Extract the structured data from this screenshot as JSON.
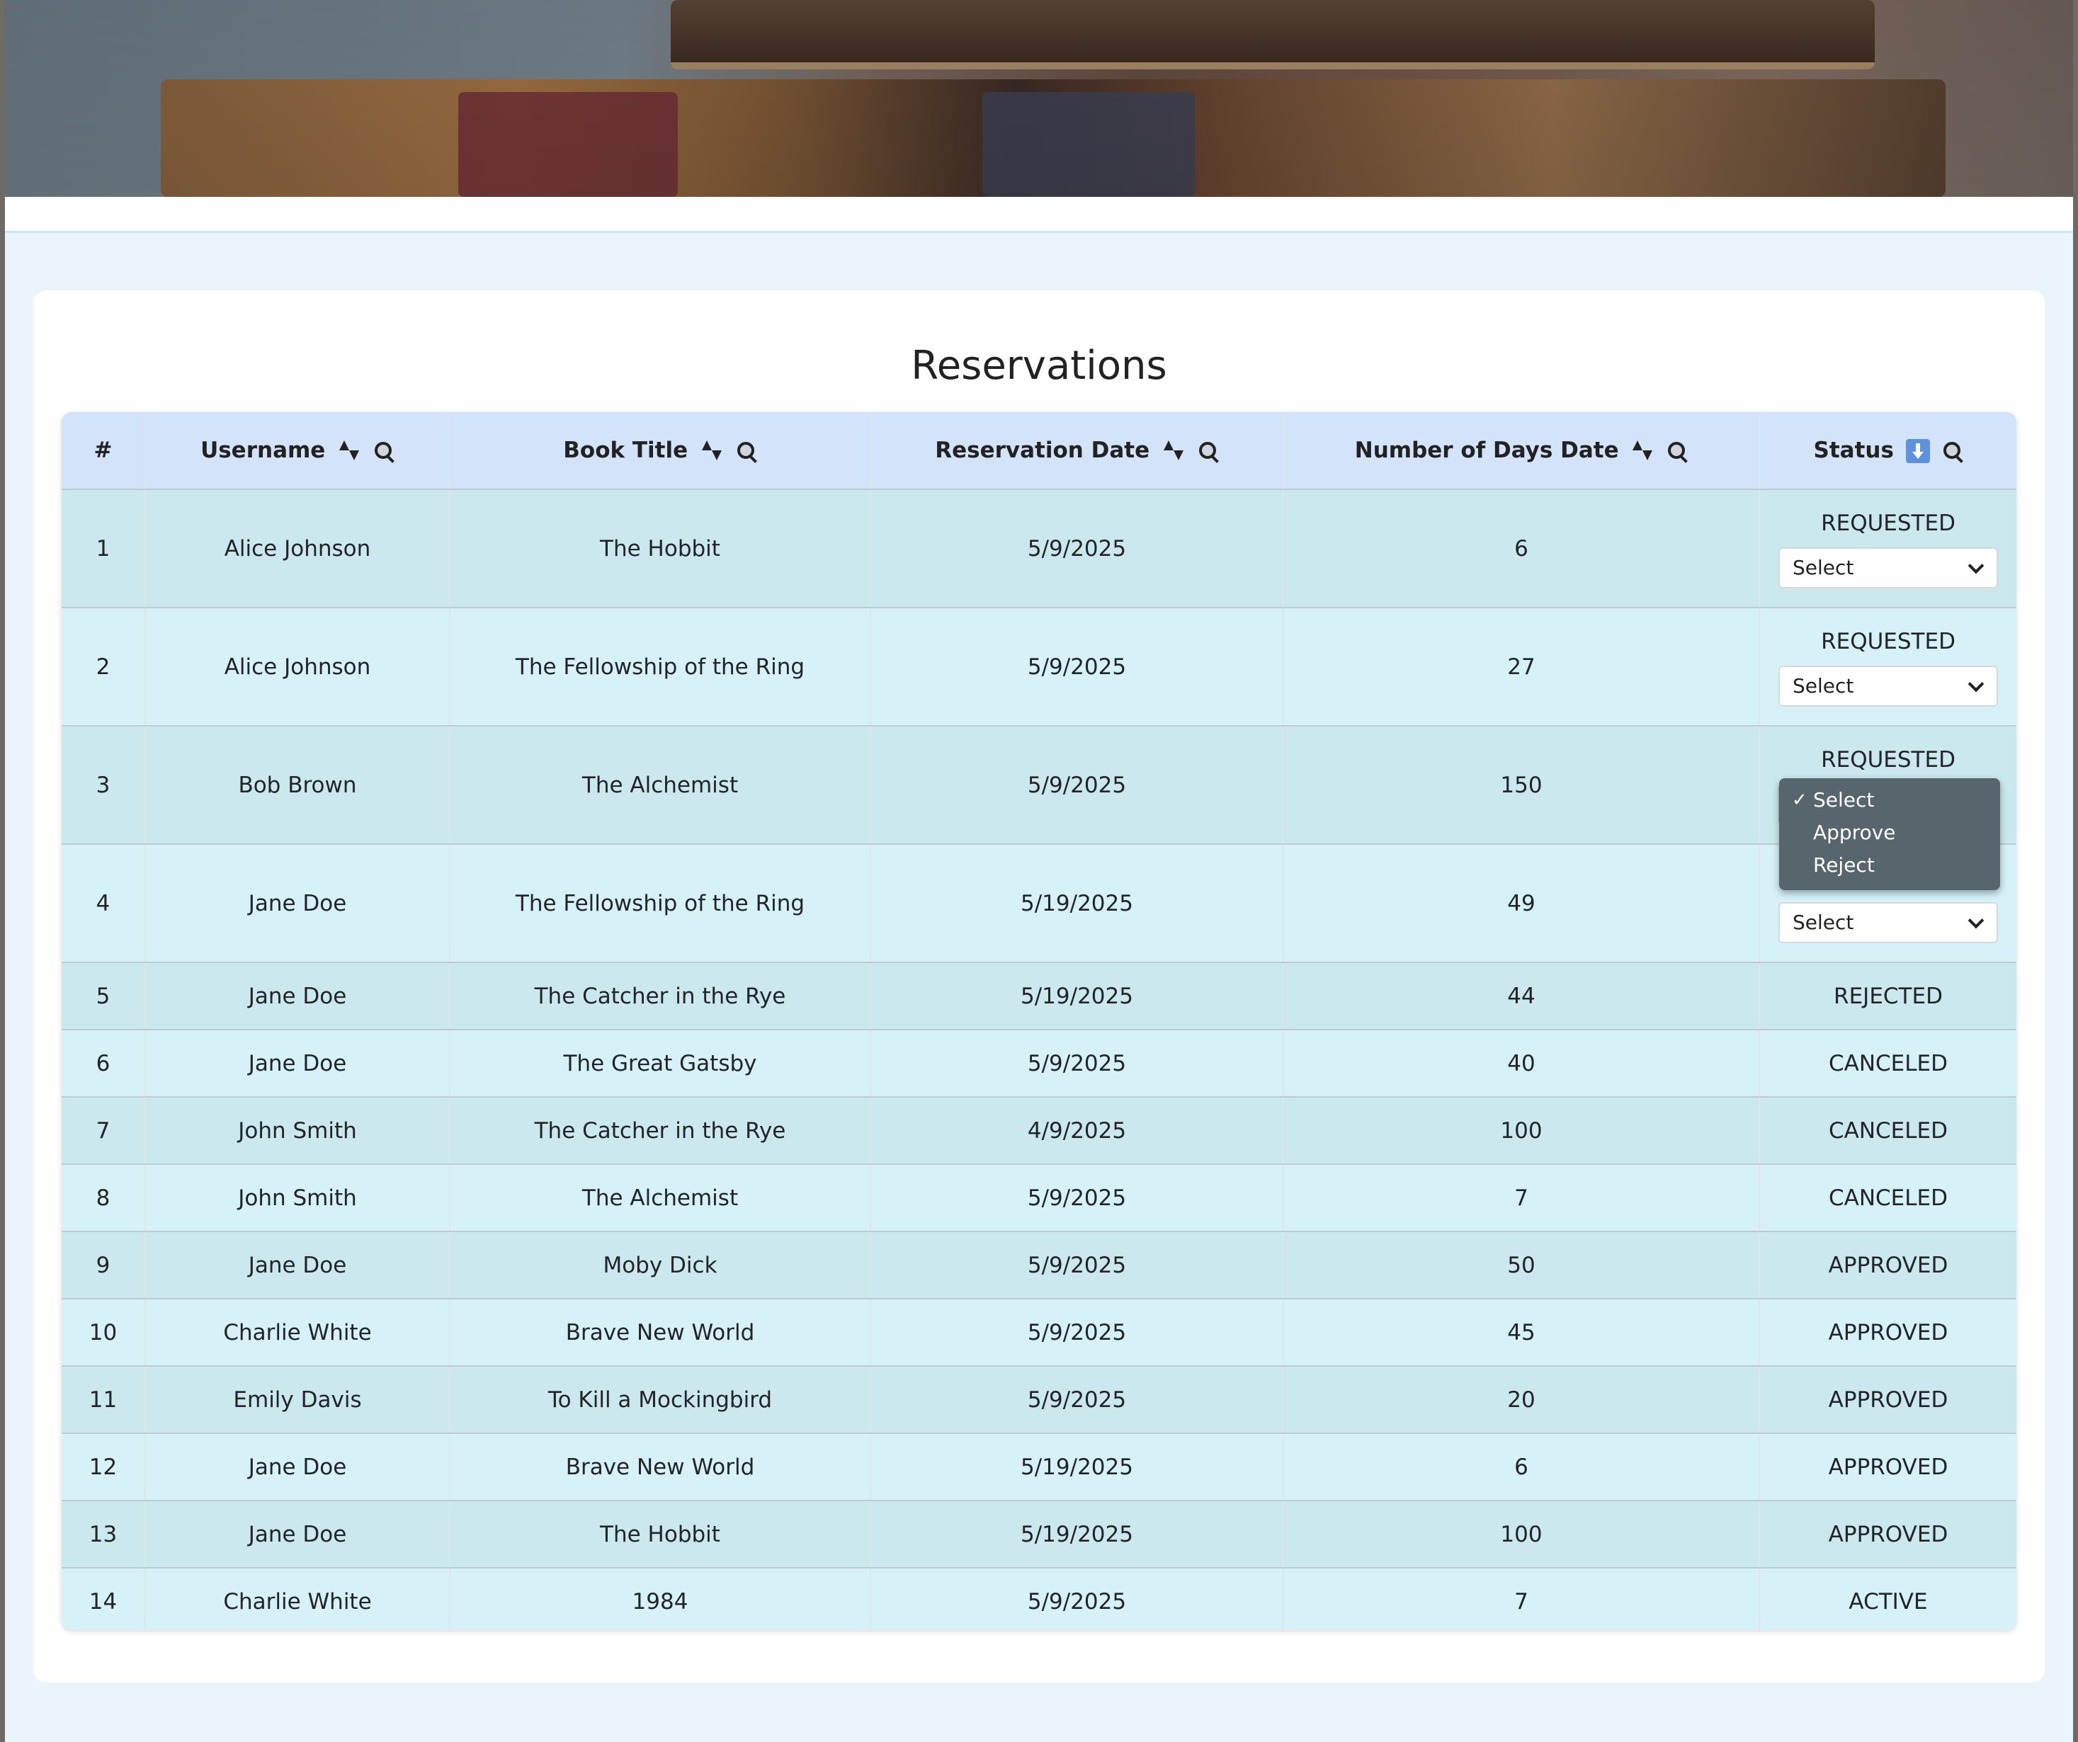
{
  "page": {
    "title": "Reservations"
  },
  "table": {
    "headers": [
      {
        "label": "#"
      },
      {
        "label": "Username"
      },
      {
        "label": "Book Title"
      },
      {
        "label": "Reservation Date"
      },
      {
        "label": "Number of Days Date"
      },
      {
        "label": "Status"
      }
    ],
    "rows": [
      {
        "num": "1",
        "username": "Alice Johnson",
        "book": "The Hobbit",
        "date": "5/9/2025",
        "days": "6",
        "status": "REQUESTED",
        "select": "Select"
      },
      {
        "num": "2",
        "username": "Alice Johnson",
        "book": "The Fellowship of the Ring",
        "date": "5/9/2025",
        "days": "27",
        "status": "REQUESTED",
        "select": "Select"
      },
      {
        "num": "3",
        "username": "Bob Brown",
        "book": "The Alchemist",
        "date": "5/9/2025",
        "days": "150",
        "status": "REQUESTED",
        "select": "Select"
      },
      {
        "num": "4",
        "username": "Jane Doe",
        "book": "The Fellowship of the Ring",
        "date": "5/19/2025",
        "days": "49",
        "status": "",
        "select": "Select"
      },
      {
        "num": "5",
        "username": "Jane Doe",
        "book": "The Catcher in the Rye",
        "date": "5/19/2025",
        "days": "44",
        "status": "REJECTED"
      },
      {
        "num": "6",
        "username": "Jane Doe",
        "book": "The Great Gatsby",
        "date": "5/9/2025",
        "days": "40",
        "status": "CANCELED"
      },
      {
        "num": "7",
        "username": "John Smith",
        "book": "The Catcher in the Rye",
        "date": "4/9/2025",
        "days": "100",
        "status": "CANCELED"
      },
      {
        "num": "8",
        "username": "John Smith",
        "book": "The Alchemist",
        "date": "5/9/2025",
        "days": "7",
        "status": "CANCELED"
      },
      {
        "num": "9",
        "username": "Jane Doe",
        "book": "Moby Dick",
        "date": "5/9/2025",
        "days": "50",
        "status": "APPROVED"
      },
      {
        "num": "10",
        "username": "Charlie White",
        "book": "Brave New World",
        "date": "5/9/2025",
        "days": "45",
        "status": "APPROVED"
      },
      {
        "num": "11",
        "username": "Emily Davis",
        "book": "To Kill a Mockingbird",
        "date": "5/9/2025",
        "days": "20",
        "status": "APPROVED"
      },
      {
        "num": "12",
        "username": "Jane Doe",
        "book": "Brave New World",
        "date": "5/19/2025",
        "days": "6",
        "status": "APPROVED"
      },
      {
        "num": "13",
        "username": "Jane Doe",
        "book": "The Hobbit",
        "date": "5/19/2025",
        "days": "100",
        "status": "APPROVED"
      },
      {
        "num": "14",
        "username": "Charlie White",
        "book": "1984",
        "date": "5/9/2025",
        "days": "7",
        "status": "ACTIVE"
      }
    ]
  },
  "dropdown": {
    "options": [
      {
        "label": "Select",
        "checked": true
      },
      {
        "label": "Approve",
        "checked": false
      },
      {
        "label": "Reject",
        "checked": false
      }
    ],
    "check_symbol": "✓"
  }
}
